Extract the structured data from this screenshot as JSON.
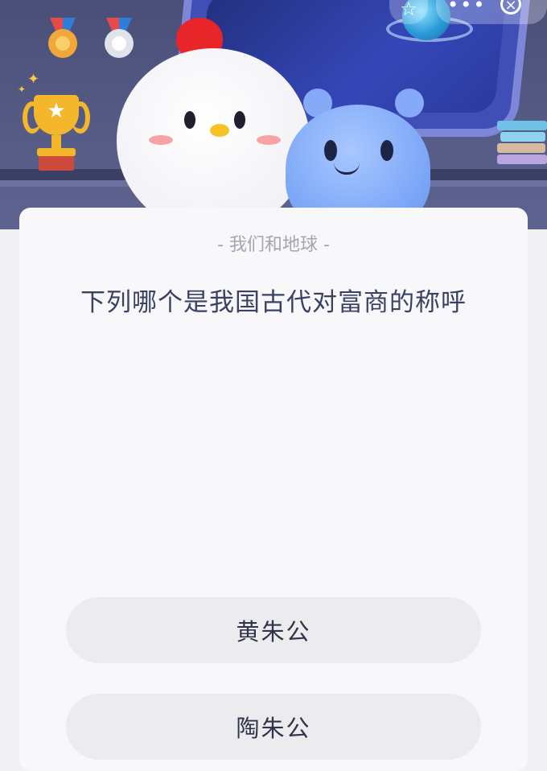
{
  "header": {
    "controls": {
      "favorite_icon": "star-outline-icon",
      "more_label": "•••",
      "close_label": "×"
    },
    "decor": {
      "medals": [
        "bronze-medal-icon",
        "silver-medal-icon"
      ],
      "trophy": "trophy-icon",
      "characters": [
        "chick-mascot",
        "blue-alien-mascot"
      ]
    }
  },
  "quiz": {
    "category": "- 我们和地球 -",
    "question": "下列哪个是我国古代对富商的称呼",
    "options": [
      {
        "label": "黄朱公"
      },
      {
        "label": "陶朱公"
      }
    ]
  },
  "colors": {
    "banner": "#4a4f78",
    "card": "#f8f8fa",
    "question_text": "#3a4163",
    "option_bg": "#ececef"
  }
}
